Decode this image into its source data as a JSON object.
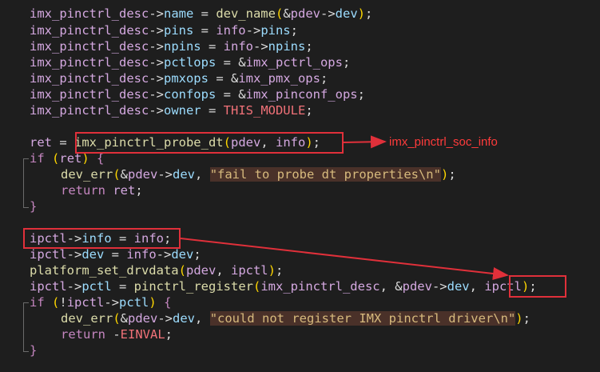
{
  "code_lines": [
    {
      "id": "l1",
      "tokens": [
        [
          "c-id",
          "imx_pinctrl_desc"
        ],
        [
          "c-op",
          "->"
        ],
        [
          "c-fld",
          "name"
        ],
        [
          "c-op",
          " = "
        ],
        [
          "c-fn",
          "dev_name"
        ],
        [
          "c-y",
          "("
        ],
        [
          "c-op",
          "&"
        ],
        [
          "c-id",
          "pdev"
        ],
        [
          "c-op",
          "->"
        ],
        [
          "c-fld",
          "dev"
        ],
        [
          "c-y",
          ")"
        ],
        [
          "c-pun",
          ";"
        ]
      ]
    },
    {
      "id": "l2",
      "tokens": [
        [
          "c-id",
          "imx_pinctrl_desc"
        ],
        [
          "c-op",
          "->"
        ],
        [
          "c-fld",
          "pins"
        ],
        [
          "c-op",
          " = "
        ],
        [
          "c-id",
          "info"
        ],
        [
          "c-op",
          "->"
        ],
        [
          "c-fld",
          "pins"
        ],
        [
          "c-pun",
          ";"
        ]
      ]
    },
    {
      "id": "l3",
      "tokens": [
        [
          "c-id",
          "imx_pinctrl_desc"
        ],
        [
          "c-op",
          "->"
        ],
        [
          "c-fld",
          "npins"
        ],
        [
          "c-op",
          " = "
        ],
        [
          "c-id",
          "info"
        ],
        [
          "c-op",
          "->"
        ],
        [
          "c-fld",
          "npins"
        ],
        [
          "c-pun",
          ";"
        ]
      ]
    },
    {
      "id": "l4",
      "tokens": [
        [
          "c-id",
          "imx_pinctrl_desc"
        ],
        [
          "c-op",
          "->"
        ],
        [
          "c-fld",
          "pctlops"
        ],
        [
          "c-op",
          " = &"
        ],
        [
          "c-id",
          "imx_pctrl_ops"
        ],
        [
          "c-pun",
          ";"
        ]
      ]
    },
    {
      "id": "l5",
      "tokens": [
        [
          "c-id",
          "imx_pinctrl_desc"
        ],
        [
          "c-op",
          "->"
        ],
        [
          "c-fld",
          "pmxops"
        ],
        [
          "c-op",
          " = &"
        ],
        [
          "c-id",
          "imx_pmx_ops"
        ],
        [
          "c-pun",
          ";"
        ]
      ]
    },
    {
      "id": "l6",
      "tokens": [
        [
          "c-id",
          "imx_pinctrl_desc"
        ],
        [
          "c-op",
          "->"
        ],
        [
          "c-fld",
          "confops"
        ],
        [
          "c-op",
          " = &"
        ],
        [
          "c-id",
          "imx_pinconf_ops"
        ],
        [
          "c-pun",
          ";"
        ]
      ]
    },
    {
      "id": "l7",
      "tokens": [
        [
          "c-id",
          "imx_pinctrl_desc"
        ],
        [
          "c-op",
          "->"
        ],
        [
          "c-fld",
          "owner"
        ],
        [
          "c-op",
          " = "
        ],
        [
          "c-mac",
          "THIS_MODULE"
        ],
        [
          "c-pun",
          ";"
        ]
      ]
    },
    {
      "id": "l8",
      "tokens": [
        [
          "c-id",
          "ret"
        ],
        [
          "c-op",
          " = "
        ],
        [
          "c-fn",
          "imx_pinctrl_probe_dt"
        ],
        [
          "c-y",
          "("
        ],
        [
          "c-id",
          "pdev"
        ],
        [
          "c-op",
          ", "
        ],
        [
          "c-id",
          "info"
        ],
        [
          "c-y",
          ")"
        ],
        [
          "c-pun",
          ";"
        ]
      ]
    },
    {
      "id": "l9",
      "tokens": [
        [
          "c-kw",
          "if"
        ],
        [
          "c-op",
          " "
        ],
        [
          "c-y",
          "("
        ],
        [
          "c-id",
          "ret"
        ],
        [
          "c-y",
          ")"
        ],
        [
          "c-op",
          " "
        ],
        [
          "c-kw",
          "{"
        ]
      ]
    },
    {
      "id": "l10",
      "tokens": [
        [
          "c-fn",
          "dev_err"
        ],
        [
          "c-y",
          "("
        ],
        [
          "c-op",
          "&"
        ],
        [
          "c-id",
          "pdev"
        ],
        [
          "c-op",
          "->"
        ],
        [
          "c-fld",
          "dev"
        ],
        [
          "c-op",
          ", "
        ],
        [
          "c-str",
          "\"fail to probe dt properties\\n\""
        ],
        [
          "c-y",
          ")"
        ],
        [
          "c-pun",
          ";"
        ]
      ]
    },
    {
      "id": "l11",
      "tokens": [
        [
          "c-kw",
          "return"
        ],
        [
          "c-op",
          " "
        ],
        [
          "c-id",
          "ret"
        ],
        [
          "c-pun",
          ";"
        ]
      ]
    },
    {
      "id": "l12",
      "tokens": [
        [
          "c-kw",
          "}"
        ]
      ]
    },
    {
      "id": "l13",
      "tokens": [
        [
          "c-id",
          "ipctl"
        ],
        [
          "c-op",
          "->"
        ],
        [
          "c-fld",
          "info"
        ],
        [
          "c-op",
          " = "
        ],
        [
          "c-id",
          "info"
        ],
        [
          "c-pun",
          ";"
        ]
      ]
    },
    {
      "id": "l14",
      "tokens": [
        [
          "c-id",
          "ipctl"
        ],
        [
          "c-op",
          "->"
        ],
        [
          "c-fld",
          "dev"
        ],
        [
          "c-op",
          " = "
        ],
        [
          "c-id",
          "info"
        ],
        [
          "c-op",
          "->"
        ],
        [
          "c-fld",
          "dev"
        ],
        [
          "c-pun",
          ";"
        ]
      ]
    },
    {
      "id": "l15",
      "tokens": [
        [
          "c-fn",
          "platform_set_drvdata"
        ],
        [
          "c-y",
          "("
        ],
        [
          "c-id",
          "pdev"
        ],
        [
          "c-op",
          ", "
        ],
        [
          "c-id",
          "ipctl"
        ],
        [
          "c-y",
          ")"
        ],
        [
          "c-pun",
          ";"
        ]
      ]
    },
    {
      "id": "l16",
      "tokens": [
        [
          "c-id",
          "ipctl"
        ],
        [
          "c-op",
          "->"
        ],
        [
          "c-fld",
          "pctl"
        ],
        [
          "c-op",
          " = "
        ],
        [
          "c-fn",
          "pinctrl_register"
        ],
        [
          "c-y",
          "("
        ],
        [
          "c-id",
          "imx_pinctrl_desc"
        ],
        [
          "c-op",
          ", &"
        ],
        [
          "c-id",
          "pdev"
        ],
        [
          "c-op",
          "->"
        ],
        [
          "c-fld",
          "dev"
        ],
        [
          "c-op",
          ", "
        ],
        [
          "c-id",
          "ipctl"
        ],
        [
          "c-y",
          ")"
        ],
        [
          "c-pun",
          ";"
        ]
      ]
    },
    {
      "id": "l17",
      "tokens": [
        [
          "c-kw",
          "if"
        ],
        [
          "c-op",
          " "
        ],
        [
          "c-y",
          "("
        ],
        [
          "c-op",
          "!"
        ],
        [
          "c-id",
          "ipctl"
        ],
        [
          "c-op",
          "->"
        ],
        [
          "c-fld",
          "pctl"
        ],
        [
          "c-y",
          ")"
        ],
        [
          "c-op",
          " "
        ],
        [
          "c-kw",
          "{"
        ]
      ]
    },
    {
      "id": "l18",
      "tokens": [
        [
          "c-fn",
          "dev_err"
        ],
        [
          "c-y",
          "("
        ],
        [
          "c-op",
          "&"
        ],
        [
          "c-id",
          "pdev"
        ],
        [
          "c-op",
          "->"
        ],
        [
          "c-fld",
          "dev"
        ],
        [
          "c-op",
          ", "
        ],
        [
          "c-str",
          "\"could not register IMX pinctrl driver\\n\""
        ],
        [
          "c-y",
          ")"
        ],
        [
          "c-pun",
          ";"
        ]
      ]
    },
    {
      "id": "l19",
      "tokens": [
        [
          "c-kw",
          "return"
        ],
        [
          "c-op",
          " -"
        ],
        [
          "c-mac",
          "EINVAL"
        ],
        [
          "c-pun",
          ";"
        ]
      ]
    },
    {
      "id": "l20",
      "tokens": [
        [
          "c-kw",
          "}"
        ]
      ]
    }
  ],
  "annotation": {
    "label": "imx_pinctrl_soc_info"
  },
  "colors": {
    "background": "#1e1e1e",
    "highlight_box": "#e0303a",
    "annotation_text": "#ff3b3b"
  }
}
